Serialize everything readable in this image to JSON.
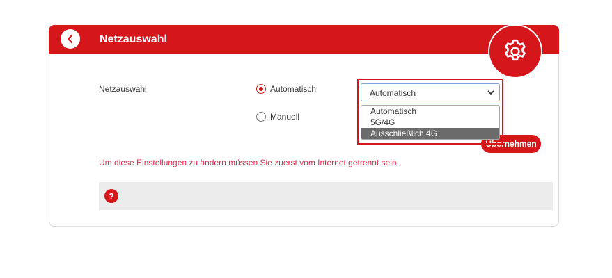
{
  "header": {
    "title": "Netzauswahl",
    "back_icon": "chevron-left-icon",
    "settings_icon": "gear-icon"
  },
  "form": {
    "field_label": "Netzauswahl",
    "radio_auto_label": "Automatisch",
    "radio_manual_label": "Manuell",
    "radio_selected": "Automatisch",
    "select_value": "Automatisch",
    "options": [
      "Automatisch",
      "5G/4G",
      "Ausschließlich 4G"
    ],
    "highlighted_option": "Ausschließlich 4G",
    "apply_label": "Übernehmen"
  },
  "warning": "Um diese Einstellungen zu ändern müssen Sie zuerst vom Internet getrennt sein.",
  "help": {
    "icon": "question-icon",
    "symbol": "?"
  },
  "colors": {
    "brand_red": "#d5171c",
    "warning_pink": "#e0284e",
    "dropdown_highlight": "#6b6b6b"
  }
}
